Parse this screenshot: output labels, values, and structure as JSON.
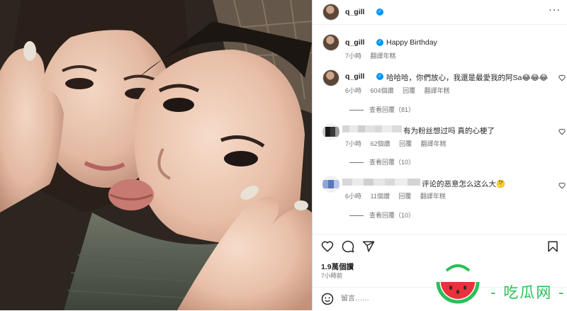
{
  "post": {
    "username": "q_gill",
    "caption": {
      "username": "q_gill",
      "text": "Happy Birthday",
      "time": "7小時",
      "translate": "翻譯年糕"
    },
    "comments": [
      {
        "username": "q_gill",
        "text": "哈哈哈，你們放心，我還是最愛我的阿Sa😂😂😂",
        "time": "6小時",
        "likes": "604個讚",
        "reply": "回覆",
        "translate": "翻譯年糕",
        "view_replies": "查看回覆（81）"
      },
      {
        "username": "",
        "text": "有为粉丝想过吗 真的心梗了",
        "time": "7小時",
        "likes": "62個讚",
        "reply": "回覆",
        "translate": "翻譯年糕",
        "view_replies": "查看回覆（10）"
      },
      {
        "username": "",
        "text": "评论的恶意怎么这么大🤔",
        "time": "6小時",
        "likes": "11個讚",
        "reply": "回覆",
        "translate": "翻譯年糕",
        "view_replies": "查看回覆（10）"
      }
    ],
    "likes_count": "1.9萬個讚",
    "posted": "7小時前",
    "add_comment_placeholder": "留言……"
  },
  "watermark": {
    "text": "- 吃瓜网 -"
  },
  "icons": [
    "more-icon",
    "verified-icon",
    "heart-icon",
    "comment-icon",
    "share-icon",
    "bookmark-icon",
    "emoji-icon"
  ],
  "colors": {
    "verified": "#0095f6",
    "text": "#262626",
    "secondary": "#737373",
    "watermark_green": "#2bbf59",
    "watermark_red": "#e8323c"
  }
}
